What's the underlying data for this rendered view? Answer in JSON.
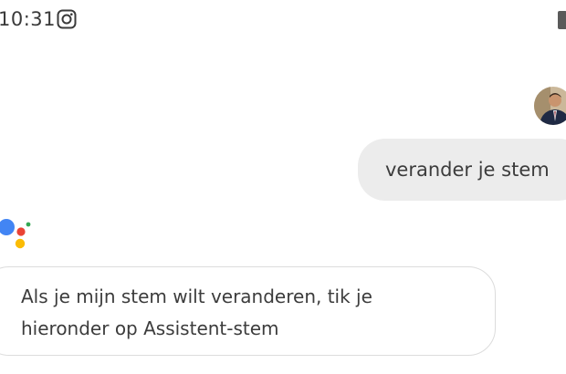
{
  "status_bar": {
    "time": "10:31",
    "notification_icon": "instagram-icon",
    "battery_icon": "battery-icon"
  },
  "conversation": {
    "user_message": "verander je stem",
    "user_avatar": "user-avatar-photo",
    "assistant_logo": "google-assistant-logo",
    "assistant_reply_lines": [
      "Als je mijn stem wilt veranderen, tik je",
      "hieronder op Assistent-stem"
    ]
  },
  "colors": {
    "background": "#ffffff",
    "user_bubble": "#ececec",
    "text": "#3c3c3c",
    "assistant_blue": "#4285F4",
    "assistant_red": "#EA4335",
    "assistant_yellow": "#FBBC05",
    "assistant_green": "#34A853"
  }
}
